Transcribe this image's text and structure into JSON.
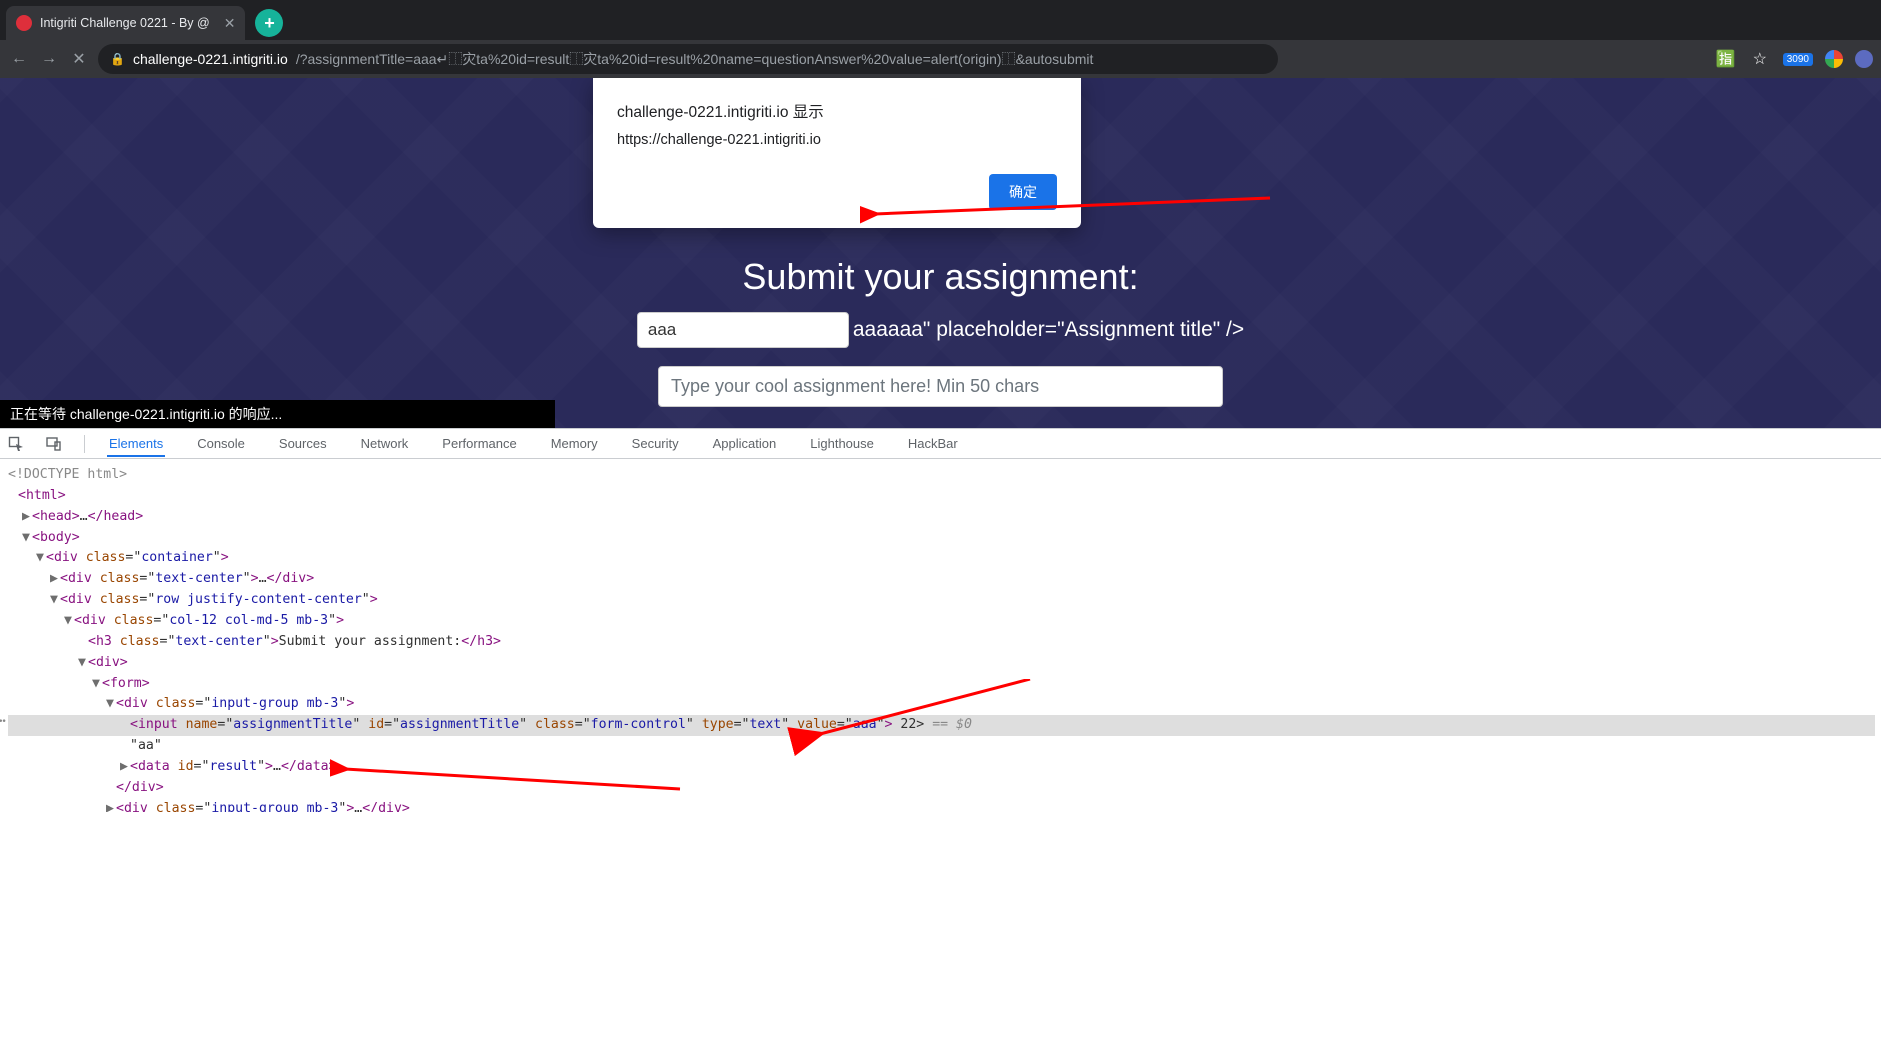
{
  "browser": {
    "tab_title": "Intigriti Challenge 0221 - By @",
    "url_host": "challenge-0221.intigriti.io",
    "url_path": "/?assignmentTitle=aaa↵⿰灾ta%20id=result⿰灾ta%20id=result%20name=questionAnswer%20value=alert(origin)⿰&autosubmit",
    "ext_badge": "3090"
  },
  "alert": {
    "line1": "challenge-0221.intigriti.io 显示",
    "line2": "https://challenge-0221.intigriti.io",
    "ok": "确定"
  },
  "page": {
    "heading": "Submit your assignment:",
    "title_value": "aaa",
    "title_tail_text": "aaaaaa\" placeholder=\"Assignment title\" />",
    "textarea_placeholder": "Type your cool assignment here! Min 50 chars",
    "status": "正在等待 challenge-0221.intigriti.io 的响应..."
  },
  "devtools": {
    "tabs": [
      "Elements",
      "Console",
      "Sources",
      "Network",
      "Performance",
      "Memory",
      "Security",
      "Application",
      "Lighthouse",
      "HackBar"
    ],
    "active_tab": "Elements",
    "dom": {
      "doctype": "<!DOCTYPE html>",
      "lines": [
        {
          "ind": 0,
          "tri": "",
          "html": "<html>"
        },
        {
          "ind": 1,
          "tri": "▶",
          "html_open": "<head>",
          "ell": "…",
          "html_close": "</head>"
        },
        {
          "ind": 1,
          "tri": "▼",
          "html": "<body>"
        },
        {
          "ind": 2,
          "tri": "▼",
          "tag": "div",
          "attrs": [
            [
              "class",
              "container"
            ]
          ]
        },
        {
          "ind": 3,
          "tri": "▶",
          "tag": "div",
          "attrs": [
            [
              "class",
              "text-center"
            ]
          ],
          "ell": "…",
          "close": "div"
        },
        {
          "ind": 3,
          "tri": "▼",
          "tag": "div",
          "attrs": [
            [
              "class",
              "row justify-content-center"
            ]
          ]
        },
        {
          "ind": 4,
          "tri": "▼",
          "tag": "div",
          "attrs": [
            [
              "class",
              "col-12 col-md-5 mb-3"
            ]
          ]
        },
        {
          "ind": 5,
          "tri": "",
          "tag": "h3",
          "attrs": [
            [
              "class",
              "text-center"
            ]
          ],
          "text": "Submit your assignment:",
          "close": "h3"
        },
        {
          "ind": 5,
          "tri": "▼",
          "tag": "div"
        },
        {
          "ind": 6,
          "tri": "▼",
          "tag": "form"
        },
        {
          "ind": 7,
          "tri": "▼",
          "tag": "div",
          "attrs": [
            [
              "class",
              "input-group mb-3"
            ]
          ]
        },
        {
          "ind": 8,
          "tri": "",
          "selected": true,
          "tag": "input",
          "attrs": [
            [
              "name",
              "assignmentTitle"
            ],
            [
              "id",
              "assignmentTitle"
            ],
            [
              "class",
              "form-control"
            ],
            [
              "type",
              "text"
            ],
            [
              "value",
              "aaa"
            ]
          ],
          "tail": " 22> ",
          "eq0": "== $0"
        },
        {
          "ind": 8,
          "tri": "",
          "rawtext": "\"aa\""
        },
        {
          "ind": 8,
          "tri": "▶",
          "tag": "data",
          "attrs": [
            [
              "id",
              "result"
            ]
          ],
          "ell": "…",
          "close": "data"
        },
        {
          "ind": 7,
          "tri": "",
          "closeonly": "div"
        },
        {
          "ind": 7,
          "tri": "▶",
          "tag": "div",
          "attrs": [
            [
              "class",
              "input-group mb-3"
            ]
          ],
          "ell": "…",
          "close": "div"
        }
      ]
    }
  }
}
